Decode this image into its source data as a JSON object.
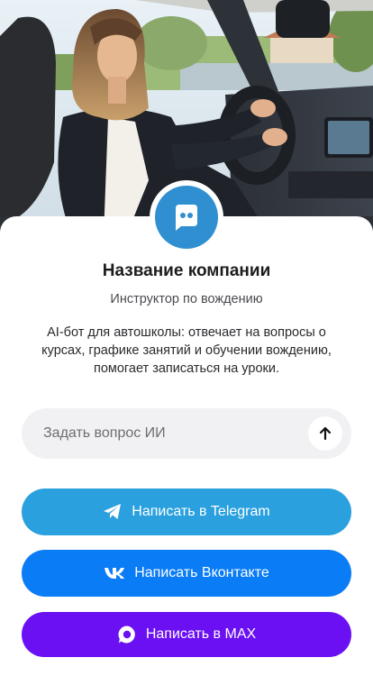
{
  "company": {
    "name": "Название компании",
    "role": "Инструктор по вождению",
    "description": "AI-бот для автошколы: отвечает на вопросы о курсах, графике занятий и обучении вождению, помогает записаться на уроки."
  },
  "ask": {
    "placeholder": "Задать вопрос ИИ",
    "send_icon": "arrow-up-icon"
  },
  "buttons": {
    "telegram": {
      "label": "Написать в Telegram",
      "icon": "telegram-icon",
      "color": "#2aa0df"
    },
    "vk": {
      "label": "Написать Вконтакте",
      "icon": "vk-icon",
      "color": "#0a7cf5"
    },
    "max": {
      "label": "Написать в MAX",
      "icon": "max-icon",
      "color": "#6a10f2"
    }
  },
  "avatar": {
    "icon": "chat-bot-icon",
    "color": "#2f8fd0"
  }
}
